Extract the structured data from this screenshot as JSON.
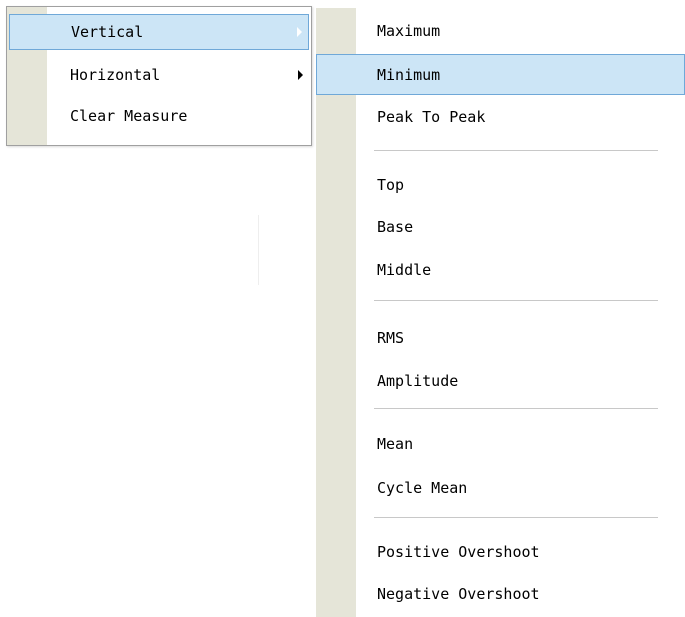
{
  "main_menu": {
    "items": [
      {
        "label": "Vertical",
        "highlighted": true,
        "has_submenu": true,
        "icon": "chevron-right-icon"
      },
      {
        "label": "Horizontal",
        "highlighted": false,
        "has_submenu": true,
        "icon": "chevron-right-icon"
      },
      {
        "label": "Clear Measure",
        "highlighted": false,
        "has_submenu": false
      }
    ]
  },
  "vertical_submenu": {
    "items": [
      {
        "label": "Maximum",
        "highlighted": false
      },
      {
        "label": "Minimum",
        "highlighted": true
      },
      {
        "label": "Peak To Peak",
        "highlighted": false
      },
      {
        "label": "Top",
        "highlighted": false
      },
      {
        "label": "Base",
        "highlighted": false
      },
      {
        "label": "Middle",
        "highlighted": false
      },
      {
        "label": "RMS",
        "highlighted": false
      },
      {
        "label": "Amplitude",
        "highlighted": false
      },
      {
        "label": "Mean",
        "highlighted": false
      },
      {
        "label": "Cycle Mean",
        "highlighted": false
      },
      {
        "label": "Positive Overshoot",
        "highlighted": false
      },
      {
        "label": "Negative Overshoot",
        "highlighted": false
      }
    ]
  },
  "colors": {
    "highlight_fill": "#cce5f6",
    "highlight_border": "#6fa8d8",
    "gutter": "#e5e5d8",
    "separator": "#c8c8c8",
    "menu_border": "#a0a0a0"
  }
}
